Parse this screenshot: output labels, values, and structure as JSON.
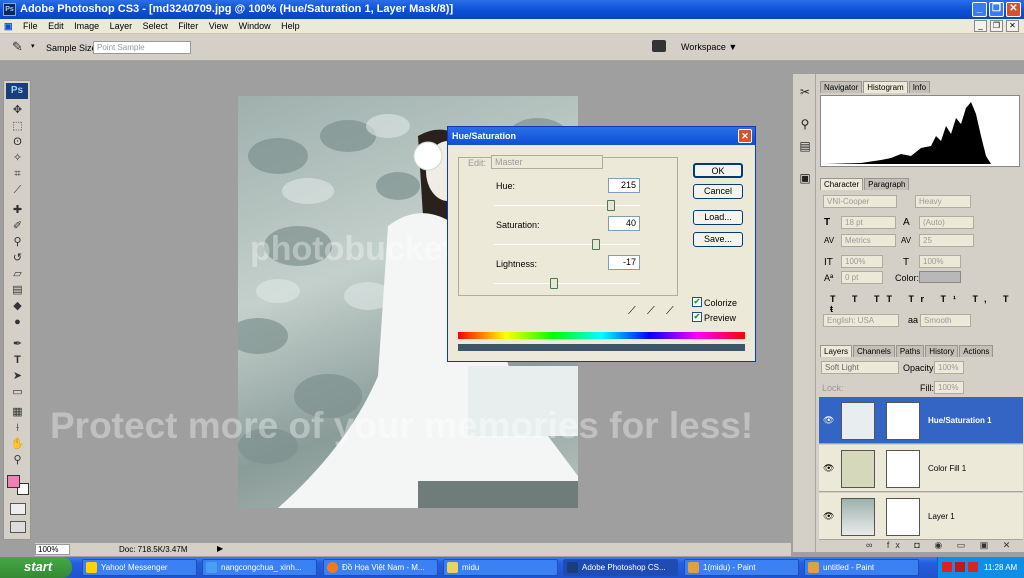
{
  "window": {
    "title": "Adobe Photoshop CS3 - [md3240709.jpg @ 100% (Hue/Saturation 1, Layer Mask/8)]"
  },
  "menu": [
    "File",
    "Edit",
    "Image",
    "Layer",
    "Select",
    "Filter",
    "View",
    "Window",
    "Help"
  ],
  "options": {
    "sample_size_label": "Sample Size:",
    "sample_size_value": "Point Sample",
    "workspace": "Workspace ▼"
  },
  "toolbox": {
    "logo": "Ps",
    "tools": [
      "move-icon",
      "marquee-icon",
      "lasso-icon",
      "magic-wand-icon",
      "crop-icon",
      "slice-icon",
      "healing-brush-icon",
      "brush-icon",
      "clone-stamp-icon",
      "history-brush-icon",
      "eraser-icon",
      "gradient-icon",
      "blur-icon",
      "dodge-icon",
      "pen-icon",
      "type-icon",
      "path-select-icon",
      "shape-icon",
      "notes-icon",
      "eyedropper-icon",
      "hand-icon",
      "zoom-icon"
    ],
    "fg_color": "#f080b8",
    "bg_color": "#ffffff"
  },
  "dialog": {
    "title": "Hue/Saturation",
    "edit_label": "Edit:",
    "edit_value": "Master",
    "hue_label": "Hue:",
    "hue_value": "215",
    "hue_level": 0.8,
    "sat_label": "Saturation:",
    "sat_value": "40",
    "sat_level": 0.7,
    "light_label": "Lightness:",
    "light_value": "-17",
    "light_level": 0.41,
    "ok": "OK",
    "cancel": "Cancel",
    "load": "Load...",
    "save": "Save...",
    "colorize": "Colorize",
    "preview": "Preview",
    "colorize_checked": true,
    "preview_checked": true
  },
  "panels": {
    "nav_tabs": [
      "Navigator",
      "Histogram",
      "Info"
    ],
    "char_tabs": [
      "Character",
      "Paragraph"
    ],
    "font_family": "VNI-Cooper",
    "font_style": "Heavy",
    "font_size": "18 pt",
    "leading": "(Auto)",
    "kerning": "Metrics",
    "tracking": "25",
    "vscale": "100%",
    "hscale": "100%",
    "baseline": "0 pt",
    "color_label": "Color:",
    "language": "English: USA",
    "aa_label": "aa",
    "antialias": "Smooth",
    "layer_tabs": [
      "Layers",
      "Channels",
      "Paths",
      "History",
      "Actions"
    ],
    "blend_mode": "Soft Light",
    "opacity_label": "Opacity:",
    "opacity": "100%",
    "lock_label": "Lock:",
    "fill_label": "Fill:",
    "fill": "100%",
    "layers": [
      {
        "name": "Hue/Saturation 1"
      },
      {
        "name": "Color Fill 1"
      },
      {
        "name": "Layer 1"
      }
    ]
  },
  "status": {
    "zoom": "100%",
    "doc": "Doc: 718.5K/3.47M"
  },
  "taskbar": {
    "start": "start",
    "items": [
      "Yahoo! Messenger",
      "nangcongchua_ xinh...",
      "Đồ Họa Việt Nam - M...",
      "midu",
      "Adobe Photoshop CS...",
      "1(midu) - Paint",
      "untitled - Paint"
    ],
    "clock": "11:28 AM"
  },
  "watermark": {
    "logo": "photobucket",
    "text": "Protect more of your memories for less!"
  },
  "colors": {
    "accent": "#0d4fd6",
    "selected_layer": "#3464c4",
    "fill_swatch": "#d6d8bc"
  }
}
